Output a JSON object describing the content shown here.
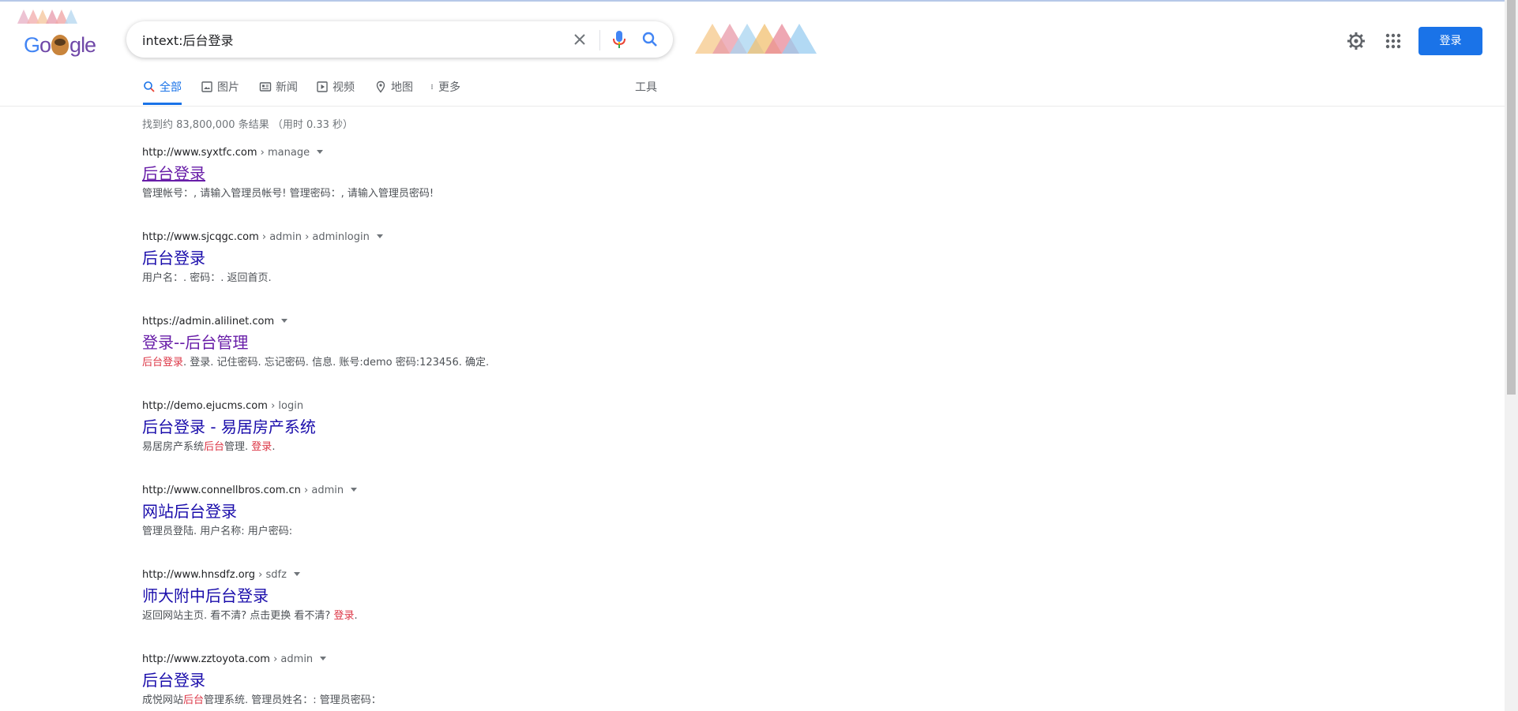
{
  "search": {
    "query": "intext:后台登录",
    "clear_icon": "close-icon",
    "mic_icon": "microphone-icon",
    "search_icon": "search-icon"
  },
  "header": {
    "logo_text": "Google",
    "signin_label": "登录",
    "settings_icon": "gear-icon",
    "apps_icon": "apps-grid-icon"
  },
  "tabs": [
    {
      "label": "全部",
      "icon": "search-icon",
      "active": true
    },
    {
      "label": "图片",
      "icon": "image-icon",
      "active": false
    },
    {
      "label": "新闻",
      "icon": "news-icon",
      "active": false
    },
    {
      "label": "视频",
      "icon": "video-icon",
      "active": false
    },
    {
      "label": "地图",
      "icon": "map-pin-icon",
      "active": false
    },
    {
      "label": "更多",
      "icon": "more-vertical-icon",
      "active": false
    }
  ],
  "tools_label": "工具",
  "result_stats": "找到约 83,800,000 条结果 （用时 0.33 秒）",
  "results": [
    {
      "url_host": "http://www.syxtfc.com",
      "url_path": " › manage",
      "title": "后台登录",
      "snippet_parts": [
        {
          "text": "管理帐号：, 请输入管理员帐号! 管理密码：, 请输入管理员密码!",
          "hl": false
        }
      ]
    },
    {
      "url_host": "http://www.sjcqgc.com",
      "url_path": " › admin › adminlogin",
      "title": "后台登录",
      "snippet_parts": [
        {
          "text": "用户名：. 密码：. 返回首页.",
          "hl": false
        }
      ]
    },
    {
      "url_host": "https://admin.alilinet.com",
      "url_path": "",
      "title": "登录--后台管理",
      "snippet_parts": [
        {
          "text": "后台登录",
          "hl": true
        },
        {
          "text": ". 登录. 记住密码. 忘记密码. 信息. 账号:demo 密码:123456. 确定.",
          "hl": false
        }
      ]
    },
    {
      "url_host": "http://demo.ejucms.com",
      "url_path": " › login",
      "title": "后台登录 - 易居房产系统",
      "snippet_parts": [
        {
          "text": "易居房产系统",
          "hl": false
        },
        {
          "text": "后台",
          "hl": true
        },
        {
          "text": "管理. ",
          "hl": false
        },
        {
          "text": "登录",
          "hl": true
        },
        {
          "text": ".",
          "hl": false
        }
      ]
    },
    {
      "url_host": "http://www.connellbros.com.cn",
      "url_path": " › admin",
      "title": "网站后台登录",
      "snippet_parts": [
        {
          "text": "管理员登陆. 用户名称: 用户密码:",
          "hl": false
        }
      ]
    },
    {
      "url_host": "http://www.hnsdfz.org",
      "url_path": " › sdfz",
      "title": "师大附中后台登录",
      "snippet_parts": [
        {
          "text": "返回网站主页. 看不清? 点击更换 看不清? ",
          "hl": false
        },
        {
          "text": "登录",
          "hl": true
        },
        {
          "text": ".",
          "hl": false
        }
      ]
    },
    {
      "url_host": "http://www.zztoyota.com",
      "url_path": " › admin",
      "title": "后台登录",
      "snippet_parts": [
        {
          "text": "成悦网站",
          "hl": false
        },
        {
          "text": "后台",
          "hl": true
        },
        {
          "text": "管理系统. 管理员姓名：: 管理员密码：",
          "hl": false
        }
      ]
    }
  ],
  "colors": {
    "accent": "#1a73e8",
    "link": "#1a0dab",
    "visited": "#681da8",
    "highlight": "#dc3545"
  }
}
